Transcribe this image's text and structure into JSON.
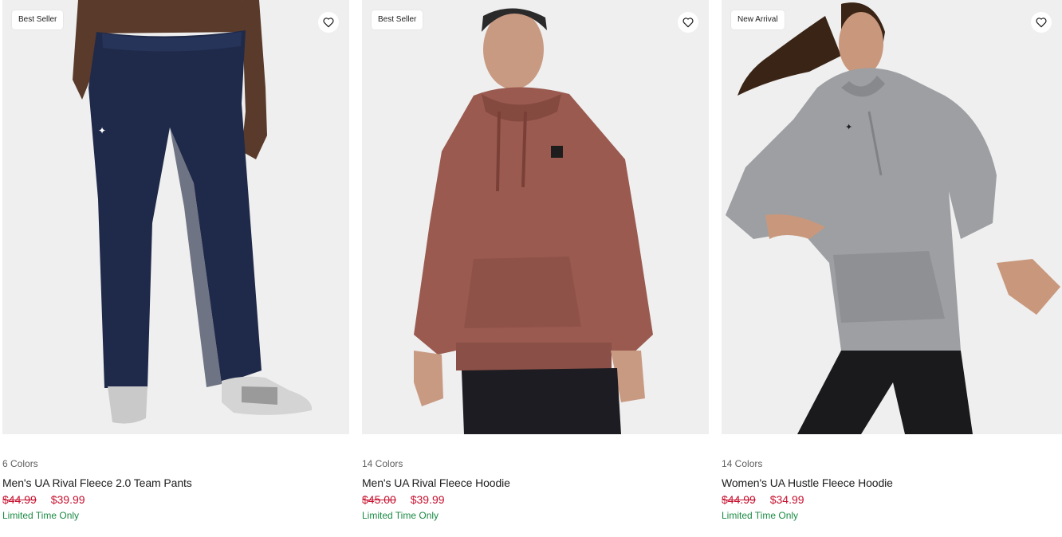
{
  "colors": {
    "sale_price": "#c7102e",
    "promo": "#1a8a43",
    "muted": "#5f5f5f",
    "image_bg": "#efefef"
  },
  "products": [
    {
      "badge": "Best Seller",
      "wishlist_icon": "heart-outline-icon",
      "colors_count": "6 Colors",
      "name": "Men's UA Rival Fleece 2.0 Team Pants",
      "price_original": "$44.99",
      "price_sale": "$39.99",
      "promo": "Limited Time Only"
    },
    {
      "badge": "Best Seller",
      "wishlist_icon": "heart-outline-icon",
      "colors_count": "14 Colors",
      "name": "Men's UA Rival Fleece Hoodie",
      "price_original": "$45.00",
      "price_sale": "$39.99",
      "promo": "Limited Time Only"
    },
    {
      "badge": "New Arrival",
      "wishlist_icon": "heart-outline-icon",
      "colors_count": "14 Colors",
      "name": "Women's UA Hustle Fleece Hoodie",
      "price_original": "$44.99",
      "price_sale": "$34.99",
      "promo": "Limited Time Only"
    }
  ]
}
